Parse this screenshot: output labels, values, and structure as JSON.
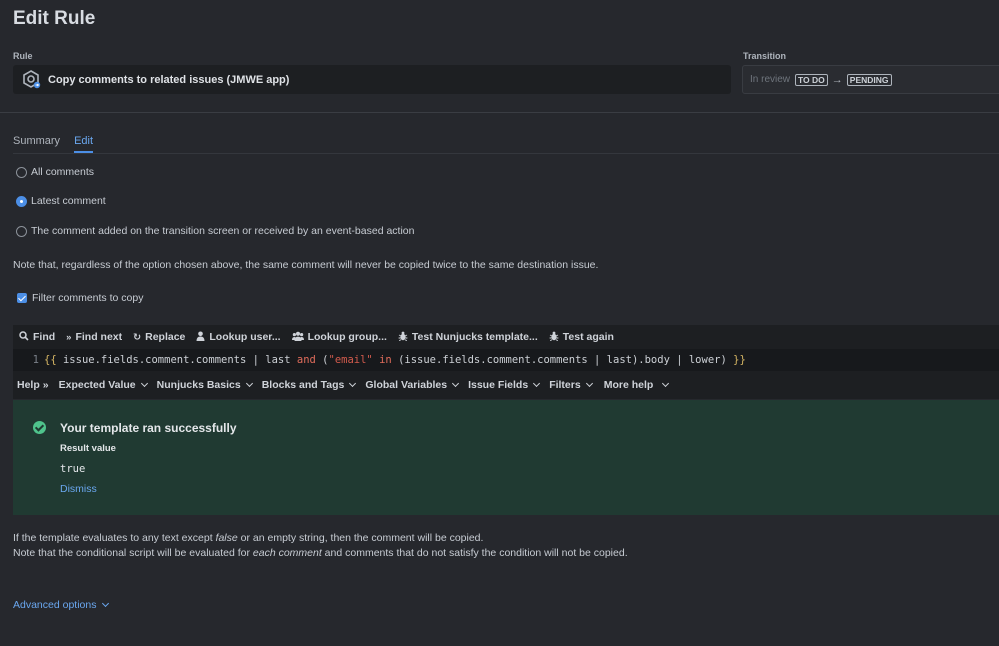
{
  "page": {
    "title": "Edit Rule"
  },
  "rule": {
    "label": "Rule",
    "name": "Copy comments to related issues (JMWE app)"
  },
  "transition": {
    "label": "Transition",
    "from_text": "In review",
    "from_status": "TO DO",
    "to_status": "PENDING"
  },
  "tabs": [
    {
      "label": "Summary"
    },
    {
      "label": "Edit"
    }
  ],
  "options": {
    "all": "All comments",
    "latest": "Latest comment",
    "transition_screen": "The comment added on the transition screen or received by an event-based action",
    "selected": "latest"
  },
  "note": "Note that, regardless of the option chosen above, the same comment will never be copied twice to the same destination issue.",
  "filter": {
    "label": "Filter comments to copy",
    "checked": true
  },
  "toolbar": {
    "find": "Find",
    "find_next": "Find next",
    "replace": "Replace",
    "lookup_user": "Lookup user...",
    "lookup_group": "Lookup group...",
    "test_template": "Test Nunjucks template...",
    "test_again": "Test again"
  },
  "code": {
    "line_number": "1",
    "open": "{{",
    "part1": " issue.fields.comment.comments | last ",
    "kw_and": "and",
    "part2": " (",
    "str_email": "\"email\"",
    "part3": " ",
    "kw_in": "in",
    "part4": " (issue.fields.comment.comments | last).body | lower) ",
    "close": "}}"
  },
  "help_bar": {
    "help": "Help",
    "menus": [
      "Expected Value",
      "Nunjucks Basics",
      "Blocks and Tags",
      "Global Variables",
      "Issue Fields",
      "Filters",
      "More help"
    ]
  },
  "result": {
    "title": "Your template ran successfully",
    "value_label": "Result value",
    "value": "true",
    "dismiss": "Dismiss"
  },
  "explanation": {
    "line1_a": "If the template evaluates to any text except ",
    "line1_em": "false",
    "line1_b": " or an empty string, then the comment will be copied.",
    "line2_a": "Note that the conditional script will be evaluated for ",
    "line2_em": "each comment",
    "line2_b": " and comments that do not satisfy the condition will not be copied."
  },
  "advanced": {
    "label": "Advanced options"
  },
  "colors": {
    "accent": "#4c8fe6",
    "success_bg": "#203a32",
    "success_icon": "#4fc38c",
    "background": "#26282d"
  }
}
